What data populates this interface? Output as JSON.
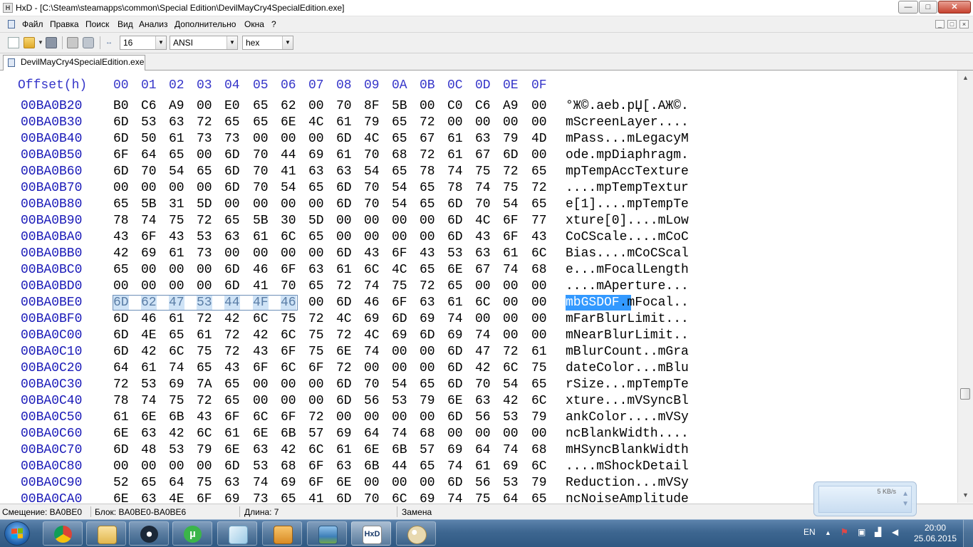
{
  "window": {
    "title": "HxD - [C:\\Steam\\steamapps\\common\\Special Edition\\DevilMayCry4SpecialEdition.exe]",
    "app_icon_text": "HxD",
    "minimize": "—",
    "maximize": "□",
    "close": "✕"
  },
  "menu": {
    "items": [
      "Файл",
      "Правка",
      "Поиск",
      "Вид",
      "Анализ",
      "Дополнительно",
      "Окна",
      "?"
    ],
    "mdi_controls": [
      "_",
      "□",
      "×"
    ]
  },
  "toolbar": {
    "bytes_per_row": "16",
    "charset": "ANSI",
    "display_mode": "hex",
    "icons": [
      "new-file-icon",
      "open-file-icon",
      "save-icon",
      "print-icon",
      "properties-icon",
      "columns-width-icon"
    ]
  },
  "tabs": [
    {
      "label": "DevilMayCry4SpecialEdition.exe"
    }
  ],
  "hex_view": {
    "offset_header": "Offset(h)",
    "column_headers": [
      "00",
      "01",
      "02",
      "03",
      "04",
      "05",
      "06",
      "07",
      "08",
      "09",
      "0A",
      "0B",
      "0C",
      "0D",
      "0E",
      "0F"
    ],
    "selected_row": 12,
    "selected_first_byte": 0,
    "selected_last_byte": 6,
    "rows": [
      {
        "offset": "00BA0B20",
        "bytes": [
          "B0",
          "C6",
          "A9",
          "00",
          "E0",
          "65",
          "62",
          "00",
          "70",
          "8F",
          "5B",
          "00",
          "C0",
          "C6",
          "A9",
          "00"
        ],
        "ascii": "°Ж©.aeb.pЏ[.AЖ©."
      },
      {
        "offset": "00BA0B30",
        "bytes": [
          "6D",
          "53",
          "63",
          "72",
          "65",
          "65",
          "6E",
          "4C",
          "61",
          "79",
          "65",
          "72",
          "00",
          "00",
          "00",
          "00"
        ],
        "ascii": "mScreenLayer...."
      },
      {
        "offset": "00BA0B40",
        "bytes": [
          "6D",
          "50",
          "61",
          "73",
          "73",
          "00",
          "00",
          "00",
          "6D",
          "4C",
          "65",
          "67",
          "61",
          "63",
          "79",
          "4D"
        ],
        "ascii": "mPass...mLegacyM"
      },
      {
        "offset": "00BA0B50",
        "bytes": [
          "6F",
          "64",
          "65",
          "00",
          "6D",
          "70",
          "44",
          "69",
          "61",
          "70",
          "68",
          "72",
          "61",
          "67",
          "6D",
          "00"
        ],
        "ascii": "ode.mpDiaphragm."
      },
      {
        "offset": "00BA0B60",
        "bytes": [
          "6D",
          "70",
          "54",
          "65",
          "6D",
          "70",
          "41",
          "63",
          "63",
          "54",
          "65",
          "78",
          "74",
          "75",
          "72",
          "65"
        ],
        "ascii": "mpTempAccTexture"
      },
      {
        "offset": "00BA0B70",
        "bytes": [
          "00",
          "00",
          "00",
          "00",
          "6D",
          "70",
          "54",
          "65",
          "6D",
          "70",
          "54",
          "65",
          "78",
          "74",
          "75",
          "72"
        ],
        "ascii": "....mpTempTextur"
      },
      {
        "offset": "00BA0B80",
        "bytes": [
          "65",
          "5B",
          "31",
          "5D",
          "00",
          "00",
          "00",
          "00",
          "6D",
          "70",
          "54",
          "65",
          "6D",
          "70",
          "54",
          "65"
        ],
        "ascii": "e[1]....mpTempTe"
      },
      {
        "offset": "00BA0B90",
        "bytes": [
          "78",
          "74",
          "75",
          "72",
          "65",
          "5B",
          "30",
          "5D",
          "00",
          "00",
          "00",
          "00",
          "6D",
          "4C",
          "6F",
          "77"
        ],
        "ascii": "xture[0]....mLow"
      },
      {
        "offset": "00BA0BA0",
        "bytes": [
          "43",
          "6F",
          "43",
          "53",
          "63",
          "61",
          "6C",
          "65",
          "00",
          "00",
          "00",
          "00",
          "6D",
          "43",
          "6F",
          "43"
        ],
        "ascii": "CoCScale....mCoC"
      },
      {
        "offset": "00BA0BB0",
        "bytes": [
          "42",
          "69",
          "61",
          "73",
          "00",
          "00",
          "00",
          "00",
          "6D",
          "43",
          "6F",
          "43",
          "53",
          "63",
          "61",
          "6C"
        ],
        "ascii": "Bias....mCoCScal"
      },
      {
        "offset": "00BA0BC0",
        "bytes": [
          "65",
          "00",
          "00",
          "00",
          "6D",
          "46",
          "6F",
          "63",
          "61",
          "6C",
          "4C",
          "65",
          "6E",
          "67",
          "74",
          "68"
        ],
        "ascii": "e...mFocalLength"
      },
      {
        "offset": "00BA0BD0",
        "bytes": [
          "00",
          "00",
          "00",
          "00",
          "6D",
          "41",
          "70",
          "65",
          "72",
          "74",
          "75",
          "72",
          "65",
          "00",
          "00",
          "00"
        ],
        "ascii": "....mAperture..."
      },
      {
        "offset": "00BA0BE0",
        "bytes": [
          "6D",
          "62",
          "47",
          "53",
          "44",
          "4F",
          "46",
          "00",
          "6D",
          "46",
          "6F",
          "63",
          "61",
          "6C",
          "00",
          "00"
        ],
        "ascii": "mbGSDOF.mFocal..",
        "ascii_selected": "mbGSDOF",
        "ascii_rest": ".mFocal.."
      },
      {
        "offset": "00BA0BF0",
        "bytes": [
          "6D",
          "46",
          "61",
          "72",
          "42",
          "6C",
          "75",
          "72",
          "4C",
          "69",
          "6D",
          "69",
          "74",
          "00",
          "00",
          "00"
        ],
        "ascii": "mFarBlurLimit..."
      },
      {
        "offset": "00BA0C00",
        "bytes": [
          "6D",
          "4E",
          "65",
          "61",
          "72",
          "42",
          "6C",
          "75",
          "72",
          "4C",
          "69",
          "6D",
          "69",
          "74",
          "00",
          "00"
        ],
        "ascii": "mNearBlurLimit.."
      },
      {
        "offset": "00BA0C10",
        "bytes": [
          "6D",
          "42",
          "6C",
          "75",
          "72",
          "43",
          "6F",
          "75",
          "6E",
          "74",
          "00",
          "00",
          "6D",
          "47",
          "72",
          "61"
        ],
        "ascii": "mBlurCount..mGra"
      },
      {
        "offset": "00BA0C20",
        "bytes": [
          "64",
          "61",
          "74",
          "65",
          "43",
          "6F",
          "6C",
          "6F",
          "72",
          "00",
          "00",
          "00",
          "6D",
          "42",
          "6C",
          "75"
        ],
        "ascii": "dateColor...mBlu"
      },
      {
        "offset": "00BA0C30",
        "bytes": [
          "72",
          "53",
          "69",
          "7A",
          "65",
          "00",
          "00",
          "00",
          "6D",
          "70",
          "54",
          "65",
          "6D",
          "70",
          "54",
          "65"
        ],
        "ascii": "rSize...mpTempTe"
      },
      {
        "offset": "00BA0C40",
        "bytes": [
          "78",
          "74",
          "75",
          "72",
          "65",
          "00",
          "00",
          "00",
          "6D",
          "56",
          "53",
          "79",
          "6E",
          "63",
          "42",
          "6C"
        ],
        "ascii": "xture...mVSyncBl"
      },
      {
        "offset": "00BA0C50",
        "bytes": [
          "61",
          "6E",
          "6B",
          "43",
          "6F",
          "6C",
          "6F",
          "72",
          "00",
          "00",
          "00",
          "00",
          "6D",
          "56",
          "53",
          "79"
        ],
        "ascii": "ankColor....mVSy"
      },
      {
        "offset": "00BA0C60",
        "bytes": [
          "6E",
          "63",
          "42",
          "6C",
          "61",
          "6E",
          "6B",
          "57",
          "69",
          "64",
          "74",
          "68",
          "00",
          "00",
          "00",
          "00"
        ],
        "ascii": "ncBlankWidth...."
      },
      {
        "offset": "00BA0C70",
        "bytes": [
          "6D",
          "48",
          "53",
          "79",
          "6E",
          "63",
          "42",
          "6C",
          "61",
          "6E",
          "6B",
          "57",
          "69",
          "64",
          "74",
          "68"
        ],
        "ascii": "mHSyncBlankWidth"
      },
      {
        "offset": "00BA0C80",
        "bytes": [
          "00",
          "00",
          "00",
          "00",
          "6D",
          "53",
          "68",
          "6F",
          "63",
          "6B",
          "44",
          "65",
          "74",
          "61",
          "69",
          "6C"
        ],
        "ascii": "....mShockDetail"
      },
      {
        "offset": "00BA0C90",
        "bytes": [
          "52",
          "65",
          "64",
          "75",
          "63",
          "74",
          "69",
          "6F",
          "6E",
          "00",
          "00",
          "00",
          "6D",
          "56",
          "53",
          "79"
        ],
        "ascii": "Reduction...mVSy"
      },
      {
        "offset": "00BA0CA0",
        "bytes": [
          "6E",
          "63",
          "4E",
          "6F",
          "69",
          "73",
          "65",
          "41",
          "6D",
          "70",
          "6C",
          "69",
          "74",
          "75",
          "64",
          "65"
        ],
        "ascii": "ncNoiseAmplitude"
      }
    ]
  },
  "status_bar": {
    "offset": "Смещение: BA0BE0",
    "block": "Блок: BA0BE0-BA0BE6",
    "length": "Длина: 7",
    "mode": "Замена"
  },
  "net_widget": {
    "speed": "5 KB/s"
  },
  "taskbar": {
    "apps": [
      "chrome-icon",
      "explorer-icon",
      "steam-icon",
      "utorrent-icon",
      "notepad-icon",
      "downloader-icon",
      "image-viewer-icon",
      "hxd-icon",
      "paint-icon"
    ],
    "language": "EN",
    "time": "20:00",
    "date": "25.06.2015"
  }
}
